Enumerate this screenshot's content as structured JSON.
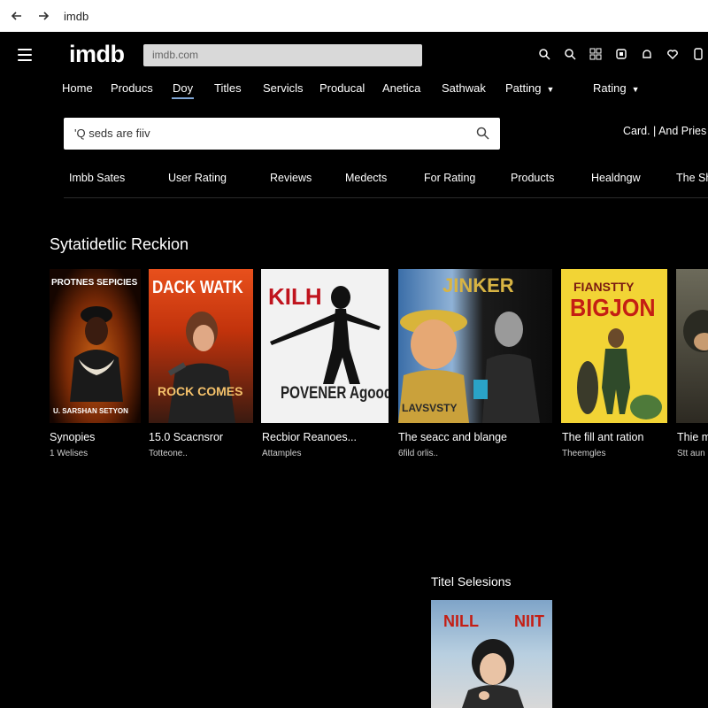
{
  "browser": {
    "url_text": "imdb"
  },
  "header": {
    "logo": "imdb",
    "url_placeholder": "imdb.com",
    "icons": [
      "search-icon",
      "search-icon",
      "grid-icon",
      "bookmark-icon",
      "bell-icon",
      "heart-icon",
      "menu-icon"
    ]
  },
  "topnav": {
    "items": [
      "Home",
      "Producs",
      "Doy",
      "Titles",
      "Servicls",
      "Producal",
      "Anetica",
      "Sathwak",
      "Patting",
      "Rating"
    ],
    "active": "Doy"
  },
  "search": {
    "placeholder": "'Q seds are fiiv"
  },
  "card_link": "Card. | And Pries",
  "categories": [
    "Imbb Sates",
    "User Rating",
    "Reviews",
    "Medects",
    "For Rating",
    "Products",
    "Healdngw",
    "The Sh"
  ],
  "section": {
    "title": "Sytatidetlic Reckion",
    "posters": [
      {
        "top_text": "PROTNES SEPICIES",
        "bottom_text": "U. SARSHAN SETYON",
        "title": "Synopies",
        "sub": "1 Welises"
      },
      {
        "top_text": "DACK WATK",
        "bottom_text": "ROCK COMES",
        "title": "15.0 Scacnsror",
        "sub": "Totteone.."
      },
      {
        "top_text": "KILH",
        "bottom_text": "POVENER Agood",
        "title": "Recbior Reanoes...",
        "sub": "Attamples"
      },
      {
        "top_text": "JINKER",
        "bottom_text": "LAVSVSTY",
        "title": "The seacc and blange",
        "sub": "6fild orlis.."
      },
      {
        "top_text": "FIANSTTY",
        "bottom_text": "BIGJON",
        "title": "The fill ant ration",
        "sub": "Theemgles"
      },
      {
        "top_text": "",
        "bottom_text": "",
        "title": "Thie m",
        "sub": "Stt aun"
      }
    ]
  },
  "subsection": {
    "title": "Titel Selesions",
    "poster": {
      "left_text": "NILL",
      "right_text": "NIIT"
    }
  }
}
